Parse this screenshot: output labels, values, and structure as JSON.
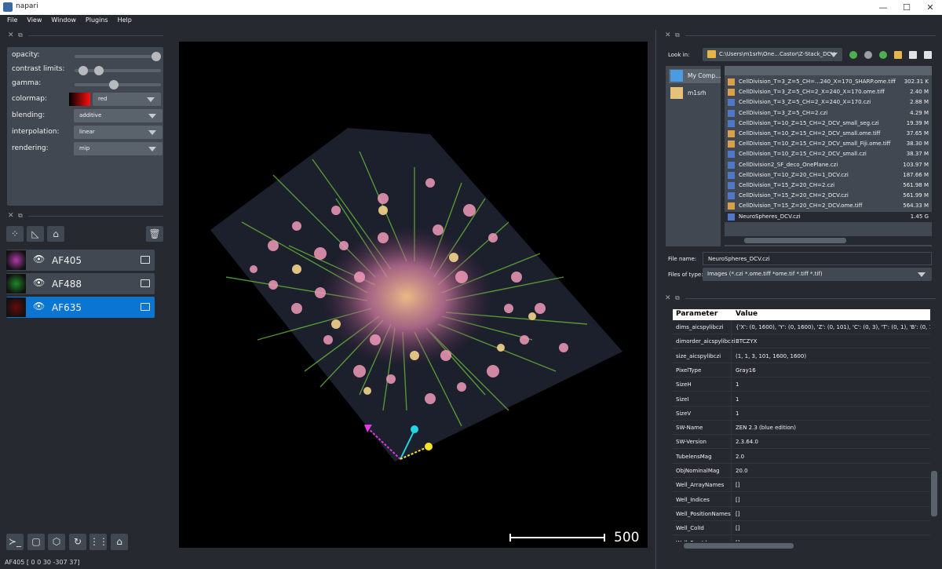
{
  "window": {
    "title": "napari"
  },
  "menu": [
    "File",
    "View",
    "Window",
    "Plugins",
    "Help"
  ],
  "layer_controls": {
    "opacity_label": "opacity:",
    "opacity_value": 1.0,
    "contrast_label": "contrast limits:",
    "contrast_range": [
      0.05,
      0.25
    ],
    "gamma_label": "gamma:",
    "gamma_value": 0.45,
    "colormap_label": "colormap:",
    "colormap_value": "red",
    "blending_label": "blending:",
    "blending_value": "additive",
    "interpolation_label": "interpolation:",
    "interpolation_value": "linear",
    "rendering_label": "rendering:",
    "rendering_value": "mip"
  },
  "layers": [
    {
      "name": "AF405",
      "selected": false,
      "thumb_color": "#b03aa8"
    },
    {
      "name": "AF488",
      "selected": false,
      "thumb_color": "#1e8a2a"
    },
    {
      "name": "AF635",
      "selected": true,
      "thumb_color": "#6a0a0a"
    }
  ],
  "status": "AF405 [   0    0   30 -307   37]",
  "canvas": {
    "scalebar_label": "500"
  },
  "file_dialog": {
    "look_in_label": "Look in:",
    "look_in_value": "C:\\Users\\m1srh\\One...Castor\\Z-Stack_DCV",
    "sidebar": [
      "My Comp...",
      "m1srh"
    ],
    "files": [
      {
        "name": "CellDivision_T=3_Z=5_CH=...240_X=170_SHARP.ome.tiff",
        "size": "302.31 K",
        "type": "tiff"
      },
      {
        "name": "CellDivision_T=3_Z=5_CH=2_X=240_X=170.ome.tiff",
        "size": "2.40 M",
        "type": "tiff"
      },
      {
        "name": "CellDivision_T=3_Z=5_CH=2_X=240_X=170.czi",
        "size": "2.88 M",
        "type": "czi"
      },
      {
        "name": "CellDivision_T=3_Z=5_CH=2.czi",
        "size": "4.29 M",
        "type": "czi"
      },
      {
        "name": "CellDivision_T=10_Z=15_CH=2_DCV_small_seg.czi",
        "size": "19.39 M",
        "type": "czi"
      },
      {
        "name": "CellDivision_T=10_Z=15_CH=2_DCV_small.ome.tiff",
        "size": "37.65 M",
        "type": "tiff"
      },
      {
        "name": "CellDivision_T=10_Z=15_CH=2_DCV_small_Fiji.ome.tiff",
        "size": "38.30 M",
        "type": "tiff"
      },
      {
        "name": "CellDivision_T=10_Z=15_CH=2_DCV_small.czi",
        "size": "38.37 M",
        "type": "czi"
      },
      {
        "name": "CellDivision2_SF_deco_OnePlane.czi",
        "size": "103.97 M",
        "type": "czi"
      },
      {
        "name": "CellDivision_T=10_Z=20_CH=1_DCV.czi",
        "size": "187.66 M",
        "type": "czi"
      },
      {
        "name": "CellDivision_T=15_Z=20_CH=2.czi",
        "size": "561.98 M",
        "type": "czi"
      },
      {
        "name": "CellDivision_T=15_Z=20_CH=2_DCV.czi",
        "size": "561.99 M",
        "type": "czi"
      },
      {
        "name": "CellDivision_T=15_Z=20_CH=2_DCV.ome.tiff",
        "size": "564.33 M",
        "type": "tiff"
      },
      {
        "name": "NeuroSpheres_DCV.czi",
        "size": "1.45 G",
        "type": "czi"
      }
    ],
    "file_name_label": "File name:",
    "file_name_value": "NeuroSpheres_DCV.czi",
    "file_type_label": "Files of type:",
    "file_type_value": "Images (*.czi *.ome.tiff *ome.tif *.tiff *.tif)"
  },
  "metadata": {
    "col_param": "Parameter",
    "col_value": "Value",
    "rows": [
      {
        "k": "dims_aicspylibczi",
        "v": "{'X': (0, 1600), 'Y': (0, 1600), 'Z': (0, 101), 'C': (0, 3), 'T': (0, 1), 'B': (0, 1)}"
      },
      {
        "k": "dimorder_aicspylibczi",
        "v": "BTCZYX"
      },
      {
        "k": "size_aicspylibczi",
        "v": "(1, 1, 3, 101, 1600, 1600)"
      },
      {
        "k": "PixelType",
        "v": "Gray16"
      },
      {
        "k": "SizeH",
        "v": "1"
      },
      {
        "k": "SizeI",
        "v": "1"
      },
      {
        "k": "SizeV",
        "v": "1"
      },
      {
        "k": "SW-Name",
        "v": "ZEN 2.3 (blue edition)"
      },
      {
        "k": "SW-Version",
        "v": "2.3.64.0"
      },
      {
        "k": "TubelensMag",
        "v": "2.0"
      },
      {
        "k": "ObjNominalMag",
        "v": "20.0"
      },
      {
        "k": "Well_ArrayNames",
        "v": "[]"
      },
      {
        "k": "Well_Indices",
        "v": "[]"
      },
      {
        "k": "Well_PositionNames",
        "v": "[]"
      },
      {
        "k": "Well_ColId",
        "v": "[]"
      },
      {
        "k": "Well_RowId",
        "v": "[]"
      }
    ]
  }
}
